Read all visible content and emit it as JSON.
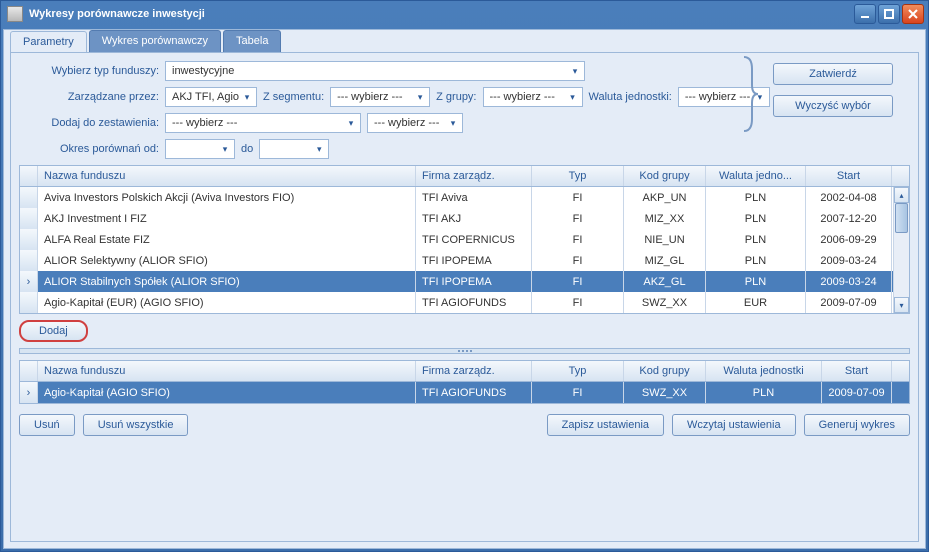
{
  "window": {
    "title": "Wykresy porównawcze inwestycji"
  },
  "tabs": [
    {
      "label": "Parametry",
      "active": true
    },
    {
      "label": "Wykres porównawczy",
      "active": false
    },
    {
      "label": "Tabela",
      "active": false
    }
  ],
  "form": {
    "typ_label": "Wybierz typ funduszy:",
    "typ_value": "inwestycyjne",
    "zarz_label": "Zarządzane przez:",
    "zarz_value": "AKJ TFI, Agio...",
    "seg_label": "Z segmentu:",
    "seg_value": "--- wybierz ---",
    "grupy_label": "Z grupy:",
    "grupy_value": "--- wybierz ---",
    "waluta_label": "Waluta jednostki:",
    "waluta_value": "--- wybierz ---",
    "dodaj_label": "Dodaj do zestawienia:",
    "dodaj_val1": "--- wybierz ---",
    "dodaj_val2": "--- wybierz ---",
    "okres_label": "Okres porównań od:",
    "do_label": "do"
  },
  "actions": {
    "zatwierdz": "Zatwierdź",
    "wyczysc": "Wyczyść wybór",
    "dodaj": "Dodaj",
    "usun": "Usuń",
    "usun_wszystkie": "Usuń wszystkie",
    "zapisz": "Zapisz ustawienia",
    "wczytaj": "Wczytaj ustawienia",
    "generuj": "Generuj wykres"
  },
  "grid1": {
    "headers": {
      "name": "Nazwa funduszu",
      "firm": "Firma zarządz.",
      "typ": "Typ",
      "kod": "Kod grupy",
      "wal": "Waluta jedno...",
      "start": "Start"
    },
    "rows": [
      {
        "name": "Aviva Investors Polskich Akcji (Aviva Investors FIO)",
        "firm": "TFI Aviva",
        "typ": "FI",
        "kod": "AKP_UN",
        "wal": "PLN",
        "start": "2002-04-08",
        "sel": false
      },
      {
        "name": "AKJ Investment I FIZ",
        "firm": "TFI AKJ",
        "typ": "FI",
        "kod": "MIZ_XX",
        "wal": "PLN",
        "start": "2007-12-20",
        "sel": false
      },
      {
        "name": "ALFA Real Estate FIZ",
        "firm": "TFI COPERNICUS",
        "typ": "FI",
        "kod": "NIE_UN",
        "wal": "PLN",
        "start": "2006-09-29",
        "sel": false
      },
      {
        "name": "ALIOR Selektywny (ALIOR SFIO)",
        "firm": "TFI IPOPEMA",
        "typ": "FI",
        "kod": "MIZ_GL",
        "wal": "PLN",
        "start": "2009-03-24",
        "sel": false
      },
      {
        "name": "ALIOR Stabilnych Spółek (ALIOR SFIO)",
        "firm": "TFI IPOPEMA",
        "typ": "FI",
        "kod": "AKZ_GL",
        "wal": "PLN",
        "start": "2009-03-24",
        "sel": true
      },
      {
        "name": "Agio-Kapitał (EUR) (AGIO SFIO)",
        "firm": "TFI AGIOFUNDS",
        "typ": "FI",
        "kod": "SWZ_XX",
        "wal": "EUR",
        "start": "2009-07-09",
        "sel": false
      }
    ]
  },
  "grid2": {
    "headers": {
      "name": "Nazwa funduszu",
      "firm": "Firma zarządz.",
      "typ": "Typ",
      "kod": "Kod grupy",
      "wal": "Waluta jednostki",
      "start": "Start"
    },
    "rows": [
      {
        "name": "Agio-Kapitał  (AGIO SFIO)",
        "firm": "TFI AGIOFUNDS",
        "typ": "FI",
        "kod": "SWZ_XX",
        "wal": "PLN",
        "start": "2009-07-09",
        "sel": true
      }
    ]
  }
}
